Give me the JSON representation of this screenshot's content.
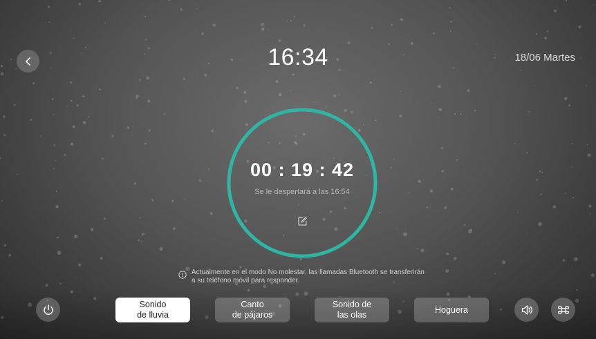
{
  "header": {
    "time": "16:34",
    "date": "18/06 Martes"
  },
  "timer": {
    "remaining": "00 : 19 : 42",
    "wake_text": "Se le despertará a las 16:54",
    "progress_color": "#2fb5a3"
  },
  "notice": {
    "text": "Actualmente en el modo No molestar, las llamadas Bluetooth se transferirán a su teléfono móvil para responder."
  },
  "sounds": [
    {
      "label": "Sonido\nde lluvia",
      "active": true
    },
    {
      "label": "Canto\nde pájaros",
      "active": false
    },
    {
      "label": "Sonido de\nlas olas",
      "active": false
    },
    {
      "label": "Hoguera",
      "active": false
    }
  ],
  "icons": {
    "back": "chevron-left-icon",
    "edit": "edit-icon",
    "info": "info-icon",
    "power": "power-icon",
    "volume": "volume-icon",
    "fan": "fan-icon"
  }
}
